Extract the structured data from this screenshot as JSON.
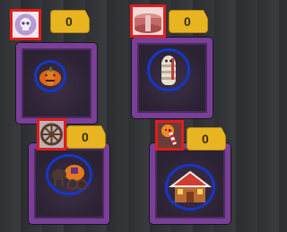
{
  "cards": [
    {
      "id": "skull-lantern",
      "cost": "0",
      "item_icon": "skull-icon",
      "ingredient_icon": "pumpkin-icon"
    },
    {
      "id": "mummy-box",
      "cost": "0",
      "item_icon": "gift-box-icon",
      "ingredient_icon": "mummy-icon"
    },
    {
      "id": "wheel-carriage",
      "cost": "0",
      "item_icon": "wagon-wheel-icon",
      "ingredient_icon": "pumpkin-carriage-icon"
    },
    {
      "id": "candy-gingerbread",
      "cost": "0",
      "item_icon": "candy-cane-icon",
      "ingredient_icon": "gingerbread-house-icon"
    }
  ]
}
